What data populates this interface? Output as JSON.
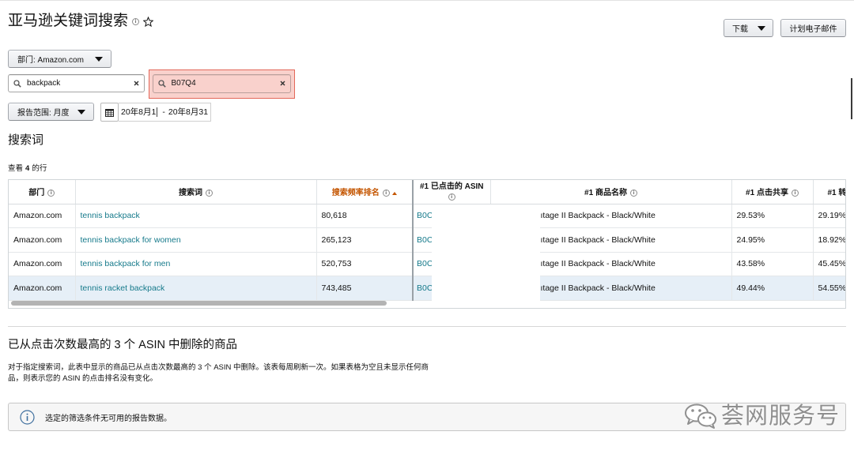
{
  "page": {
    "title": "亚马逊关键词搜索"
  },
  "toolbar": {
    "download_label": "下载",
    "schedule_email_label": "计划电子邮件"
  },
  "filters": {
    "department_label": "部门: Amazon.com",
    "search_keyword": "backpack",
    "search_asin": "B07Q4",
    "report_range_label": "报告范围: 月度",
    "date_start": "20年8月1",
    "date_separator": "-",
    "date_end": "20年8月31"
  },
  "search_terms": {
    "heading": "搜索词",
    "row_count_prefix": "查看",
    "row_count": "4",
    "row_count_suffix": "的行",
    "sorted_column_index": 2,
    "selected_row_index": 3,
    "columns": [
      "部门",
      "搜索词",
      "搜索频率排名",
      "#1 已点击的 ASIN",
      "#1 商品名称",
      "#1 点击共享",
      "#1 转"
    ],
    "rows": [
      {
        "department": "Amazon.com",
        "search_term": "tennis backpack",
        "search_frequency_rank": "80,618",
        "asin": "B0C",
        "product_name": "ıtage II Backpack - Black/White",
        "click_share": "29.53%",
        "conversion_share": "29.19%"
      },
      {
        "department": "Amazon.com",
        "search_term": "tennis backpack for women",
        "search_frequency_rank": "265,123",
        "asin": "B0C",
        "product_name": "ıtage II Backpack - Black/White",
        "click_share": "24.95%",
        "conversion_share": "18.92%"
      },
      {
        "department": "Amazon.com",
        "search_term": "tennis backpack for men",
        "search_frequency_rank": "520,753",
        "asin": "B0C",
        "product_name": "ıtage II Backpack - Black/White",
        "click_share": "43.58%",
        "conversion_share": "45.45%"
      },
      {
        "department": "Amazon.com",
        "search_term": "tennis racket backpack",
        "search_frequency_rank": "743,485",
        "asin": "B0C",
        "product_name": "ıtage II Backpack - Black/White",
        "click_share": "49.44%",
        "conversion_share": "54.55%"
      }
    ]
  },
  "removed_section": {
    "heading": "已从点击次数最高的 3 个 ASIN 中删除的商品",
    "description_lines": [
      "对于指定搜索词，此表中显示的商品已从点击次数最高的 3 个 ASIN 中删除。该表每周刷新一次。如果表格为空且未显示任何商",
      "品，则表示您的 ASIN 的点击排名没有变化。"
    ]
  },
  "alert": {
    "text": "选定的筛选条件无可用的报告数据。"
  },
  "watermark": {
    "text": "荟网服务号"
  },
  "icons": {
    "title_info": "info-icon",
    "favorite": "star-outline-icon",
    "dropdown": "caret-down-icon",
    "search": "search-icon",
    "clear": "close-icon",
    "calendar": "calendar-icon",
    "sort": "sort-ascending-icon",
    "alert": "info-circle-icon",
    "watermark_logo": "wechat-logo-icon"
  },
  "colors": {
    "link": "#167a8b",
    "sorted_header": "#c45500",
    "highlight_border": "#e3685a",
    "highlight_fill": "#f9d1cc",
    "selected_row": "#e6eff7",
    "button_top": "#f7f8fa",
    "button_bottom": "#e7e9ec"
  }
}
